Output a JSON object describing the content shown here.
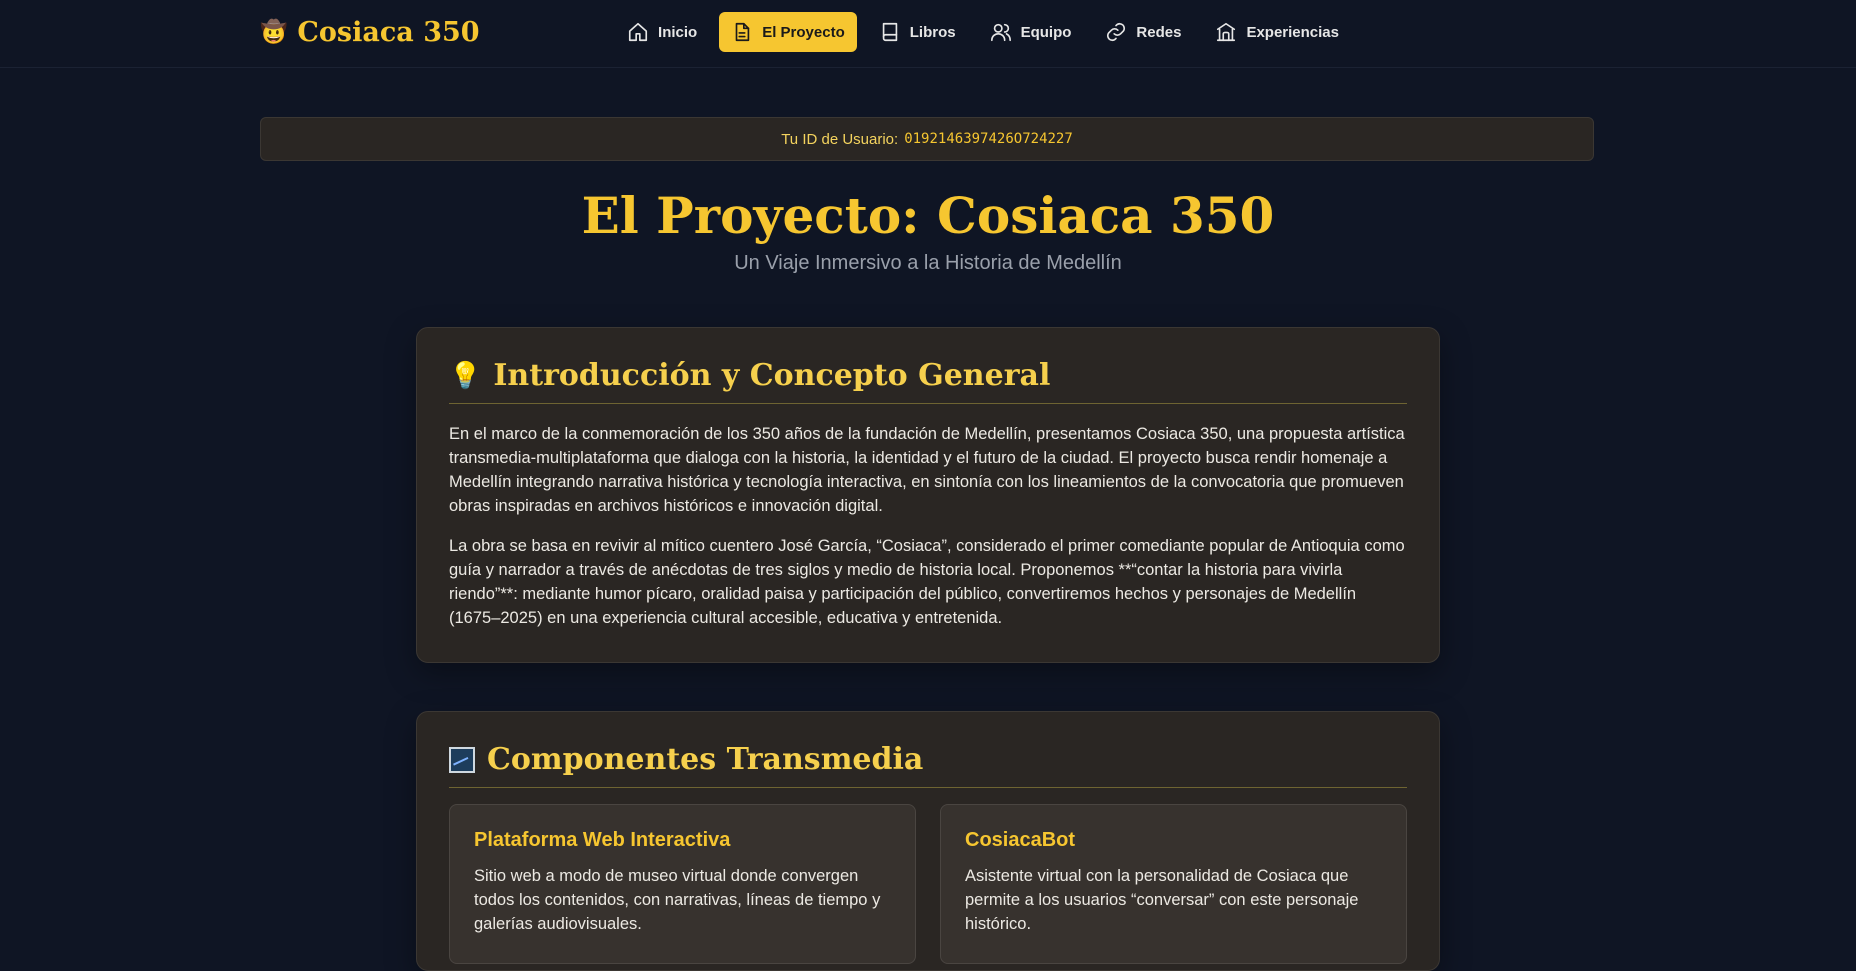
{
  "brand": {
    "icon": "🤠",
    "name": "Cosiaca 350"
  },
  "nav": [
    {
      "label": "Inicio",
      "icon": "home-icon",
      "active": false
    },
    {
      "label": "El Proyecto",
      "icon": "document-icon",
      "active": true
    },
    {
      "label": "Libros",
      "icon": "book-icon",
      "active": false
    },
    {
      "label": "Equipo",
      "icon": "users-icon",
      "active": false
    },
    {
      "label": "Redes",
      "icon": "link-icon",
      "active": false
    },
    {
      "label": "Experiencias",
      "icon": "theater-icon",
      "active": false
    }
  ],
  "user": {
    "label": "Tu ID de Usuario:",
    "id": "0192146397426O724227"
  },
  "page": {
    "title": "El Proyecto: Cosiaca 350",
    "subtitle": "Un Viaje Inmersivo a la Historia de Medellín"
  },
  "intro": {
    "icon": "💡",
    "heading": "Introducción y Concepto General",
    "paragraphs": [
      "En el marco de la conmemoración de los 350 años de la fundación de Medellín, presentamos Cosiaca 350, una propuesta artística transmedia-multiplataforma que dialoga con la historia, la identidad y el futuro de la ciudad. El proyecto busca rendir homenaje a Medellín integrando narrativa histórica y tecnología interactiva, en sintonía con los lineamientos de la convocatoria que promueven obras inspiradas en archivos históricos e innovación digital.",
      "La obra se basa en revivir al mítico cuentero José García, “Cosiaca”, considerado el primer comediante popular de Antioquia como guía y narrador a través de anécdotas de tres siglos y medio de historia local. Proponemos **“contar la historia para vivirla riendo”**: mediante humor pícaro, oralidad paisa y participación del público, convertiremos hechos y personajes de Medellín (1675–2025) en una experiencia cultural accesible, educativa y entretenida."
    ]
  },
  "components": {
    "icon": "picture-icon",
    "heading": "Componentes Transmedia",
    "items": [
      {
        "title": "Plataforma Web Interactiva",
        "text": "Sitio web a modo de museo virtual donde convergen todos los contenidos, con narrativas, líneas de tiempo y galerías audiovisuales."
      },
      {
        "title": "CosiacaBot",
        "text": "Asistente virtual con la personalidad de Cosiaca que permite a los usuarios “conversar” con este personaje histórico."
      }
    ]
  },
  "colors": {
    "accent": "#f6c630",
    "background": "#0f1524",
    "card": "#2a2623"
  }
}
